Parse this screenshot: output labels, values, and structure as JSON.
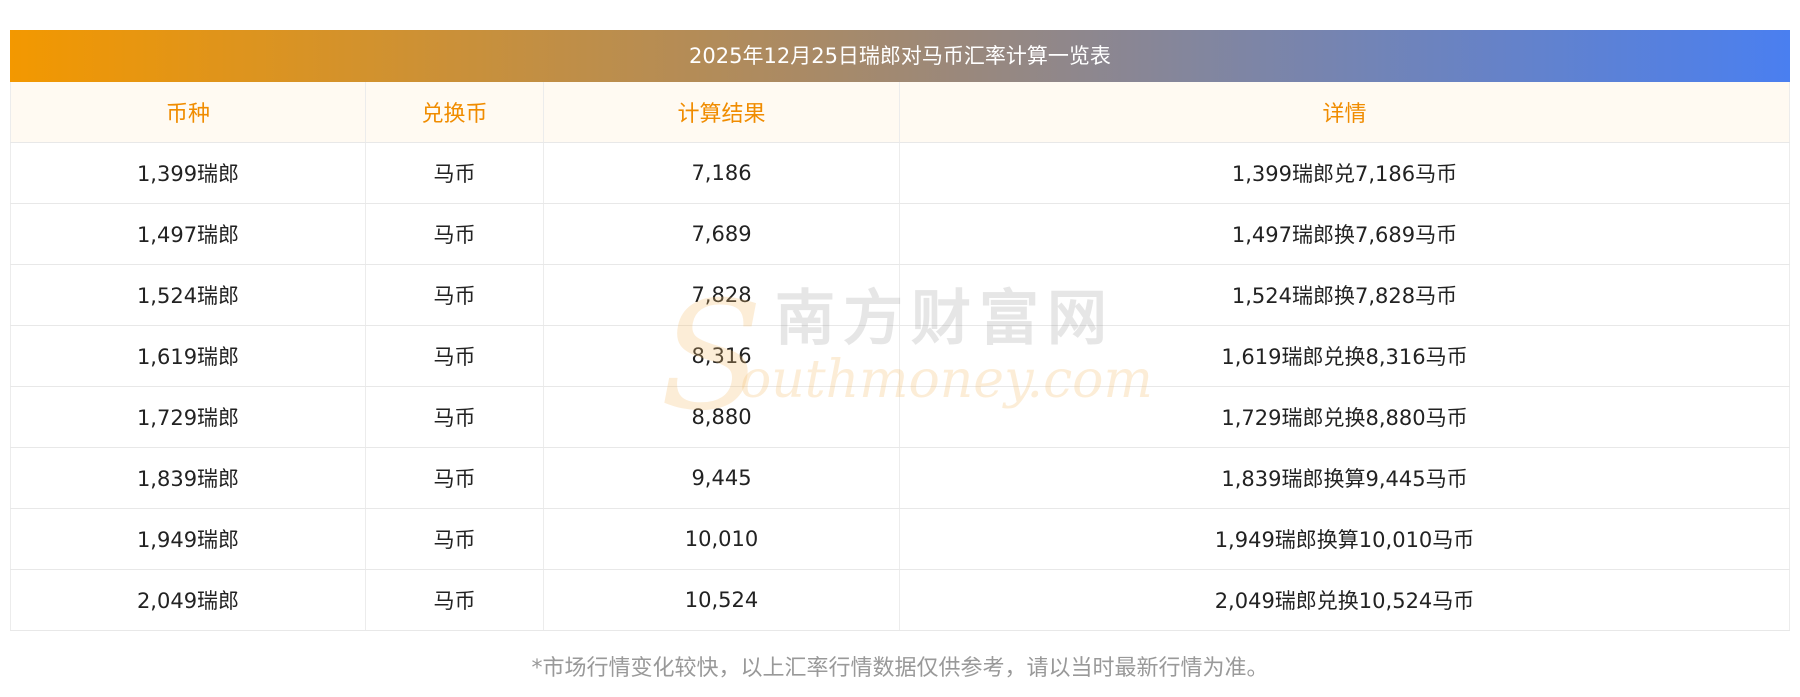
{
  "title": "2025年12月25日瑞郎对马币汇率计算一览表",
  "headers": [
    "币种",
    "兑换币",
    "计算结果",
    "详情"
  ],
  "rows": [
    [
      "1,399瑞郎",
      "马币",
      "7,186",
      "1,399瑞郎兑7,186马币"
    ],
    [
      "1,497瑞郎",
      "马币",
      "7,689",
      "1,497瑞郎换7,689马币"
    ],
    [
      "1,524瑞郎",
      "马币",
      "7,828",
      "1,524瑞郎换7,828马币"
    ],
    [
      "1,619瑞郎",
      "马币",
      "8,316",
      "1,619瑞郎兑换8,316马币"
    ],
    [
      "1,729瑞郎",
      "马币",
      "8,880",
      "1,729瑞郎兑换8,880马币"
    ],
    [
      "1,839瑞郎",
      "马币",
      "9,445",
      "1,839瑞郎换算9,445马币"
    ],
    [
      "1,949瑞郎",
      "马币",
      "10,010",
      "1,949瑞郎换算10,010马币"
    ],
    [
      "2,049瑞郎",
      "马币",
      "10,524",
      "2,049瑞郎兑换10,524马币"
    ]
  ],
  "watermark": {
    "letter": "S",
    "chinese": "南方财富网",
    "english": "outhmoney.com"
  },
  "note": "*市场行情变化较快，以上汇率行情数据仅供参考，请以当时最新行情为准。",
  "colors": {
    "header_text": "#f08c00",
    "title_gradient_start": "#f39800",
    "title_gradient_end": "#4a7ff0"
  }
}
